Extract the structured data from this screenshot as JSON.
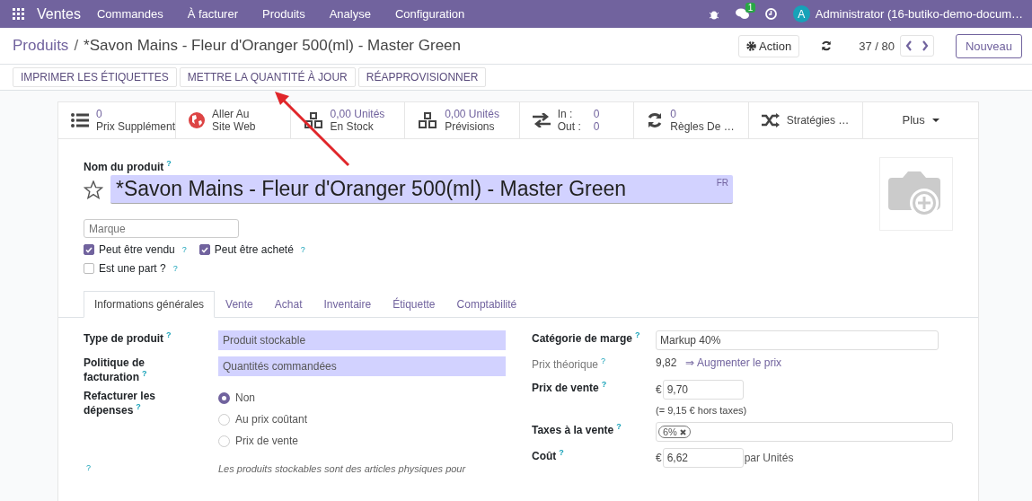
{
  "navbar": {
    "brand": "Ventes",
    "menu": [
      "Commandes",
      "À facturer",
      "Produits",
      "Analyse",
      "Configuration"
    ],
    "chat_badge": "1",
    "avatar": "A",
    "user": "Administrator (16-butiko-demo-docum…"
  },
  "control_panel": {
    "breadcrumb": "Produits",
    "separator": "/",
    "title": "*Savon Mains - Fleur d'Oranger 500(ml) - Master Green",
    "action": "Action",
    "pager": "37 / 80",
    "new_button": "Nouveau"
  },
  "header_buttons": [
    "IMPRIMER LES ÉTIQUETTES",
    "METTRE LA QUANTITÉ À JOUR",
    "RÉAPPROVISIONNER"
  ],
  "smart_buttons": [
    {
      "kind": "stat",
      "value": "0",
      "label": "Prix Supplément"
    },
    {
      "kind": "text",
      "lines": [
        "Aller Au",
        "Site Web"
      ]
    },
    {
      "kind": "stat",
      "value": "0,00 Unités",
      "label": "En Stock"
    },
    {
      "kind": "stat",
      "value": "0,00 Unités",
      "label": "Prévisions"
    },
    {
      "kind": "inout",
      "rows": [
        {
          "label": "In :",
          "value": "0"
        },
        {
          "label": "Out :",
          "value": "0"
        }
      ]
    },
    {
      "kind": "stat",
      "value": "0",
      "label": "Règles De …"
    },
    {
      "kind": "text",
      "lines": [
        "Stratégies …"
      ]
    },
    {
      "kind": "more",
      "label": "Plus"
    }
  ],
  "form": {
    "name_label": "Nom du produit",
    "name_help": "?",
    "name": "*Savon Mains - Fleur d'Oranger 500(ml) - Master Green",
    "lang": "FR",
    "favorite": false,
    "brand_placeholder": "Marque",
    "checkboxes": [
      {
        "label": "Peut être vendu",
        "help": "?",
        "checked": true
      },
      {
        "label": "Peut être acheté",
        "help": "?",
        "checked": true
      },
      {
        "label": "Est une part ?",
        "help": "?",
        "checked": false
      }
    ],
    "tabs": [
      {
        "label": "Informations générales",
        "selected": true
      },
      {
        "label": "Vente",
        "selected": false
      },
      {
        "label": "Achat",
        "selected": false
      },
      {
        "label": "Inventaire",
        "selected": false
      },
      {
        "label": "Étiquette",
        "selected": false
      },
      {
        "label": "Comptabilité",
        "selected": false
      }
    ],
    "left": [
      {
        "kind": "select",
        "label": "Type de produit",
        "help": "?",
        "value": "Produit stockable"
      },
      {
        "kind": "select",
        "label": "Politique de facturation",
        "help": "?",
        "value": "Quantités commandées"
      },
      {
        "kind": "radio",
        "label": "Refacturer les dépenses",
        "help": "?",
        "options": [
          {
            "label": "Non",
            "selected": true
          },
          {
            "label": "Au prix coûtant",
            "selected": false
          },
          {
            "label": "Prix de vente",
            "selected": false
          }
        ]
      },
      {
        "kind": "note",
        "help": "?",
        "text": "Les produits stockables sont des articles physiques pour"
      }
    ],
    "right": [
      {
        "kind": "input",
        "label": "Catégorie de marge",
        "help": "?",
        "value": "Markup 40%"
      },
      {
        "kind": "computed",
        "label": "Prix théorique",
        "help": "?",
        "value": "9,82",
        "link": "⇒ Augmenter le prix"
      },
      {
        "kind": "money",
        "label": "Prix de vente",
        "help": "?",
        "currency": "€",
        "value": "9,70",
        "note": "(= 9,15 € hors taxes)"
      },
      {
        "kind": "tags",
        "label": "Taxes à la vente",
        "help": "?",
        "tags": [
          "6%"
        ]
      },
      {
        "kind": "money",
        "label": "Coût",
        "help": "?",
        "currency": "€",
        "value": "6,62",
        "suffix": "par Unités"
      }
    ]
  }
}
